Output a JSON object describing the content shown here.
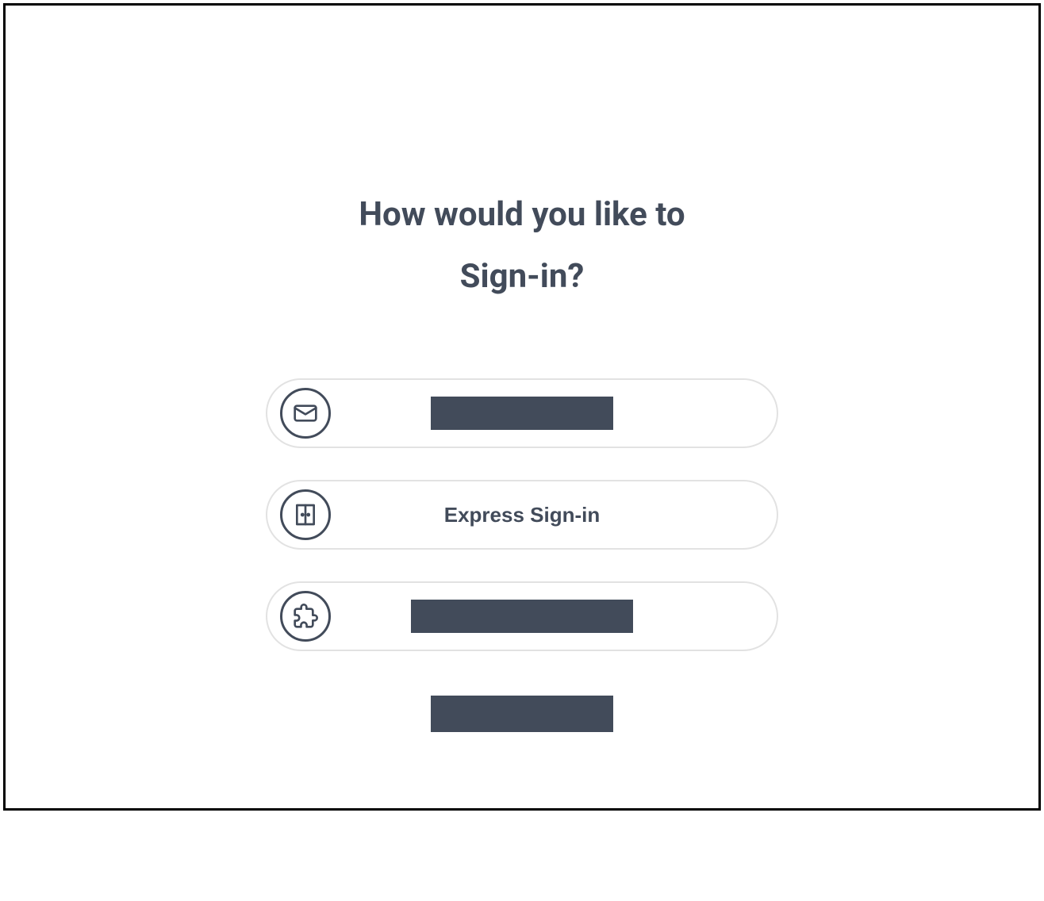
{
  "heading": {
    "line1": "How would you like to",
    "line2": "Sign-in?"
  },
  "options": [
    {
      "icon": "envelope-icon",
      "label": "",
      "redacted": true
    },
    {
      "icon": "door-icon",
      "label": "Express Sign-in",
      "redacted": false
    },
    {
      "icon": "puzzle-icon",
      "label": "",
      "redacted": true
    }
  ],
  "footer": {
    "label": "",
    "redacted": true
  }
}
